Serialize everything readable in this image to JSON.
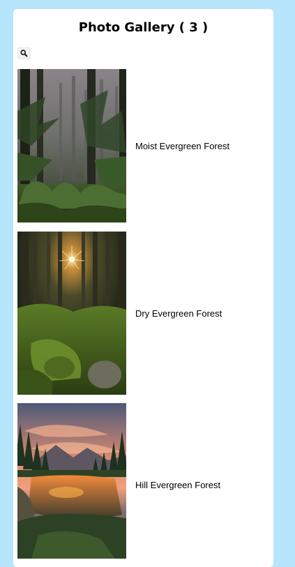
{
  "gallery": {
    "title": "Photo Gallery ( 3 )",
    "search_icon": "magnifier-icon",
    "items": [
      {
        "caption": "Moist Evergreen Forest"
      },
      {
        "caption": "Dry Evergreen Forest"
      },
      {
        "caption": "Hill Evergreen Forest"
      }
    ]
  },
  "colors": {
    "background": "#b7e5fb",
    "card": "#ffffff"
  }
}
